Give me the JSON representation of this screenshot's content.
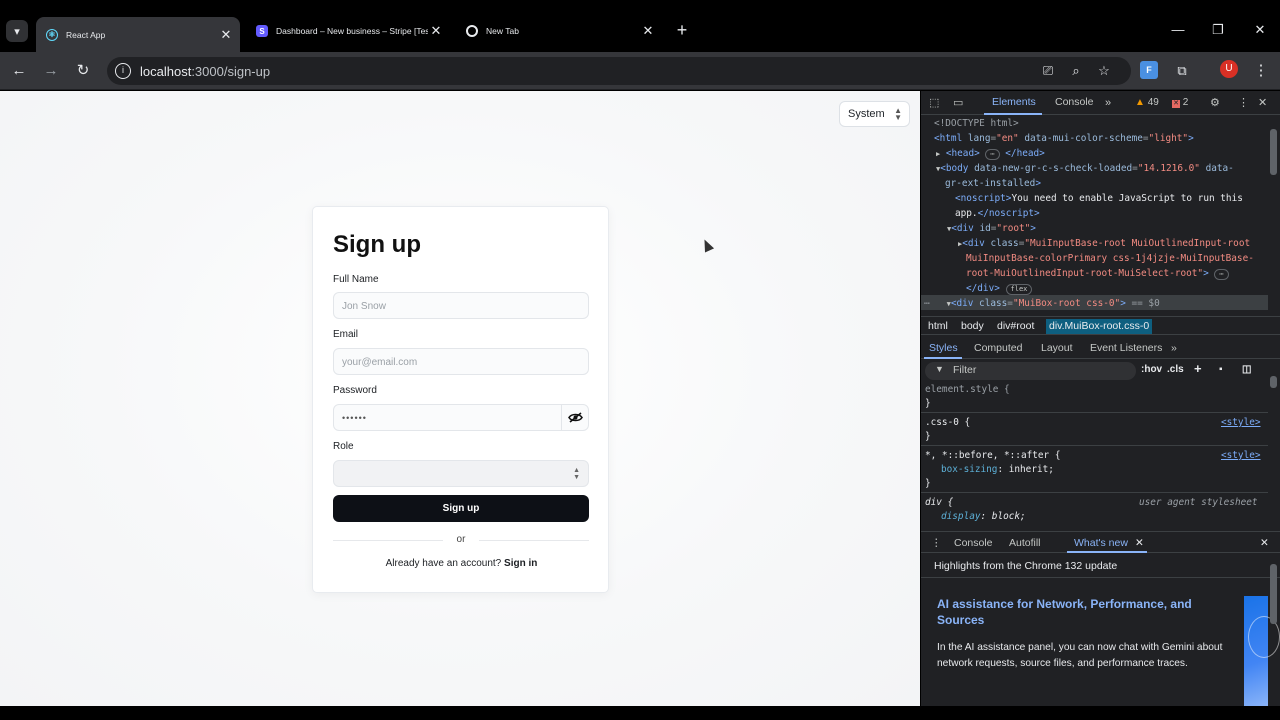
{
  "browser": {
    "tabs": [
      {
        "title": "React App",
        "favicon": "react-icon",
        "active": true
      },
      {
        "title": "Dashboard – New business – Stripe [Test]",
        "favicon": "stripe-icon",
        "active": false
      },
      {
        "title": "New Tab",
        "favicon": "chrome-icon",
        "active": false
      }
    ],
    "url_host": "localhost",
    "url_path": ":3000/sign-up",
    "avatar_letter": "U",
    "extension_label": "F"
  },
  "page": {
    "mode_select": "System",
    "title": "Sign up",
    "fields": {
      "full_name": {
        "label": "Full Name",
        "placeholder": "Jon Snow"
      },
      "email": {
        "label": "Email",
        "placeholder": "your@email.com"
      },
      "password": {
        "label": "Password",
        "value": "••••••"
      },
      "role": {
        "label": "Role",
        "value": ""
      }
    },
    "submit_label": "Sign up",
    "or_text": "or",
    "have_account_text": "Already have an account?",
    "signin_link": "Sign in"
  },
  "devtools": {
    "tabs": [
      "Elements",
      "Console"
    ],
    "warnings": "49",
    "errors": "2",
    "breadcrumbs": [
      "html",
      "body",
      "div#root",
      "div.MuiBox-root.css-0"
    ],
    "style_tabs": [
      "Styles",
      "Computed",
      "Layout",
      "Event Listeners"
    ],
    "filter_placeholder": "Filter",
    "hov": ":hov",
    "cls": ".cls",
    "drawer_tabs": [
      "Console",
      "Autofill",
      "What's new"
    ],
    "highlights": "Highlights from the Chrome 132 update",
    "news_title": "AI assistance for Network, Performance, and Sources",
    "news_body": "In the AI assistance panel, you can now chat with Gemini about network requests, source files, and performance traces."
  },
  "colors": {
    "accent": "#8ab4f8",
    "primary_button": "#0d1016",
    "warning": "#f29900",
    "error": "#e46962"
  }
}
